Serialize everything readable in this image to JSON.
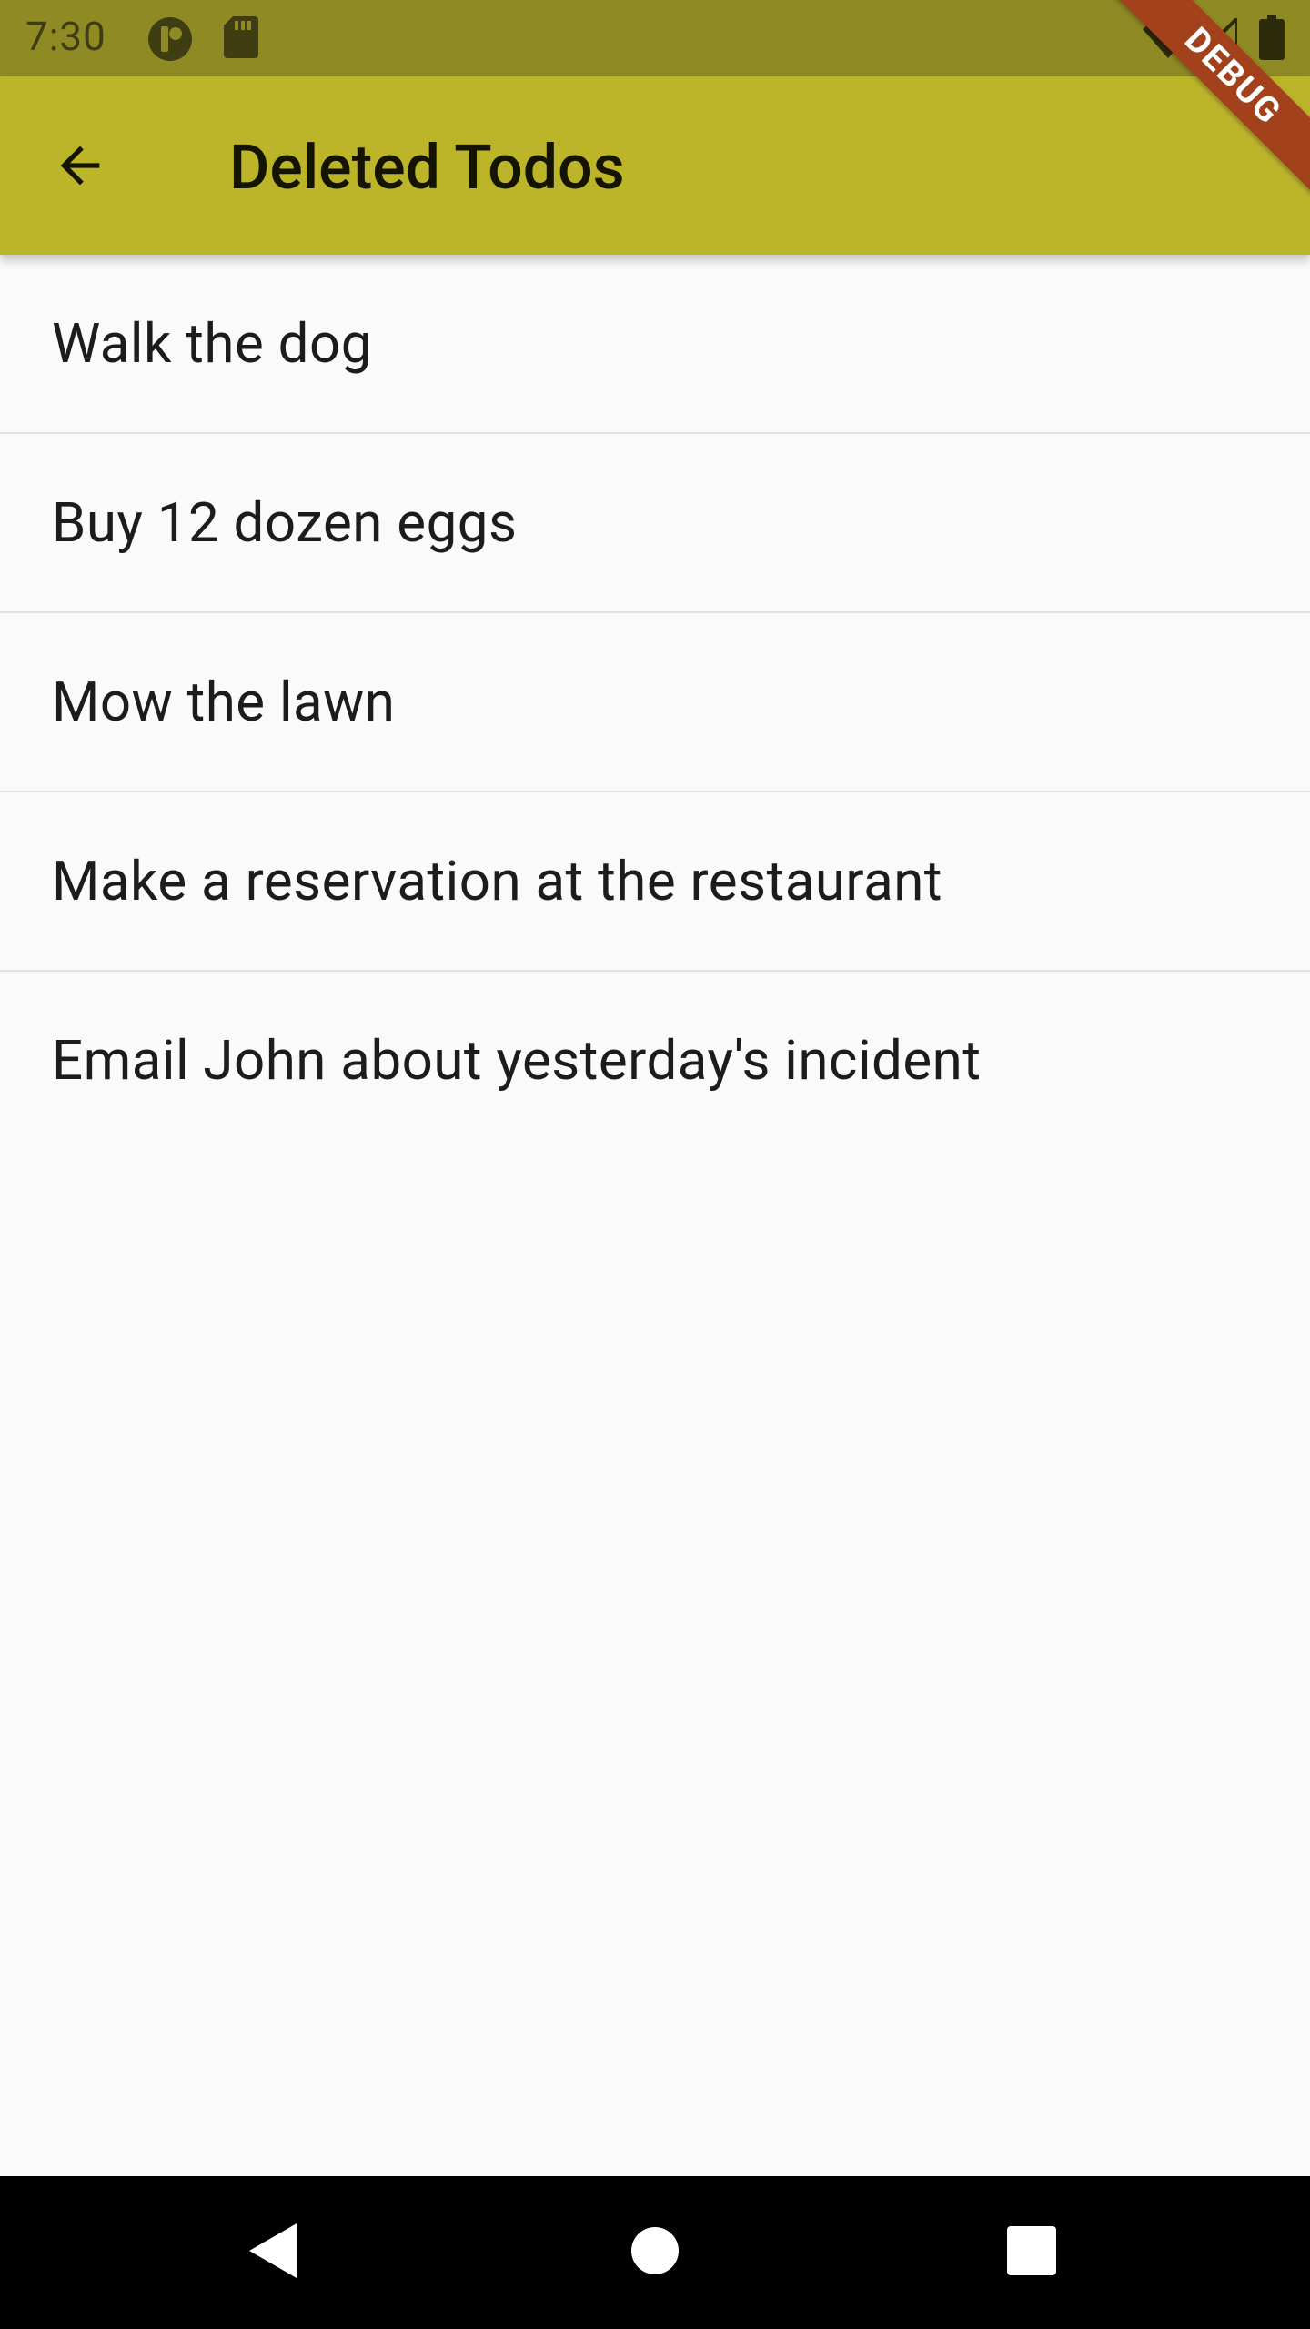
{
  "status_bar": {
    "time": "7:30",
    "left_icons": [
      "notification-circle-icon",
      "sd-card-icon"
    ],
    "right_icons": [
      "wifi-icon",
      "signal-icon",
      "battery-icon"
    ]
  },
  "app_bar": {
    "title": "Deleted Todos",
    "back_icon": "arrow-back-icon",
    "color": "#bcb52a"
  },
  "todos": [
    {
      "text": "Walk the dog"
    },
    {
      "text": "Buy 12 dozen eggs"
    },
    {
      "text": "Mow the lawn"
    },
    {
      "text": "Make a reservation at the restaurant"
    },
    {
      "text": "Email John about yesterday's incident"
    }
  ],
  "debug_banner": {
    "label": "DEBUG",
    "color": "#a3411d"
  },
  "nav_bar": {
    "icons": [
      "nav-back-icon",
      "nav-home-icon",
      "nav-recents-icon"
    ]
  }
}
